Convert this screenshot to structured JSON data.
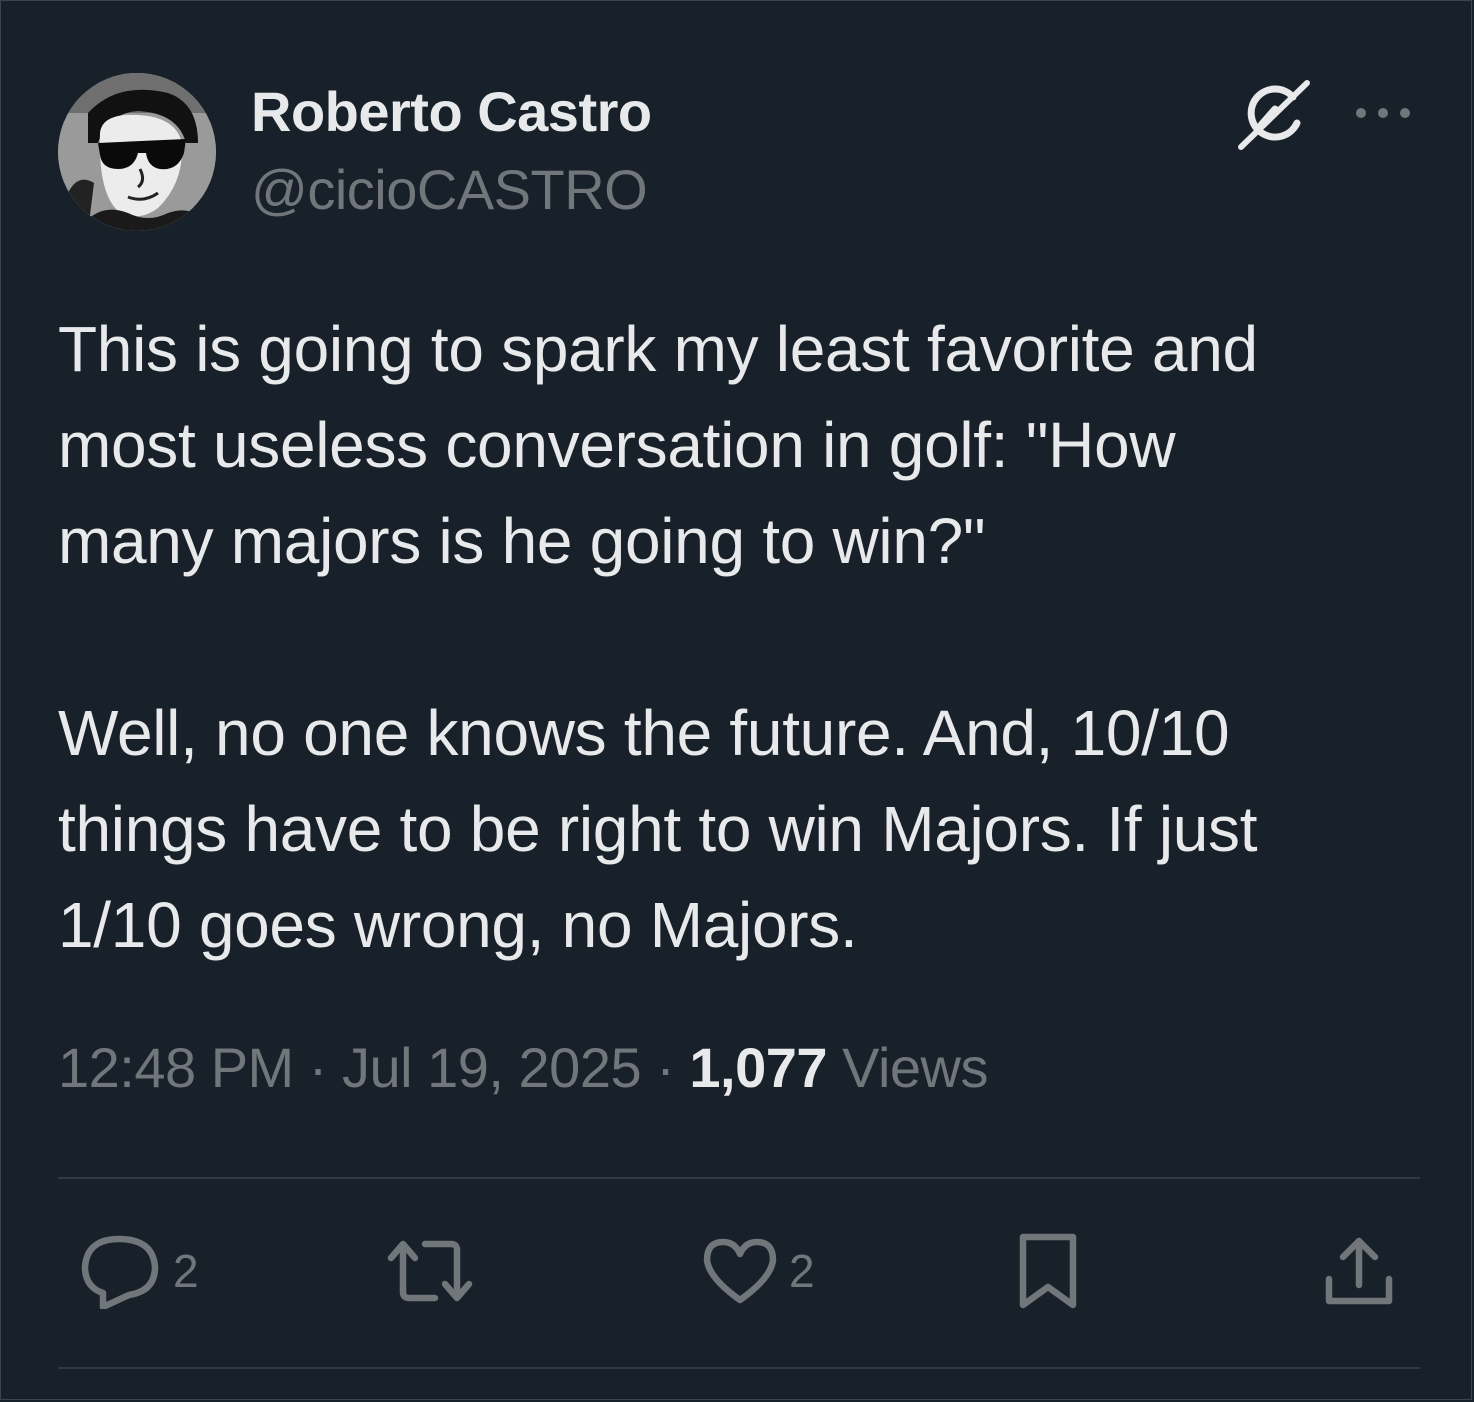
{
  "author": {
    "display_name": "Roberto Castro",
    "handle": "@cicioCASTRO"
  },
  "tweet": {
    "paragraphs": [
      [
        "This is going to spark my least favorite and",
        "most useless conversation in golf: \"How",
        "many majors is he going to win?\""
      ],
      [
        "Well, no one knows the future. And, 10/10",
        "things have to be right to win Majors. If just",
        "1/10 goes wrong, no Majors."
      ]
    ]
  },
  "meta": {
    "time": "12:48 PM",
    "separator": "·",
    "date": "Jul 19, 2025",
    "views_count": "1,077",
    "views_label": "Views"
  },
  "actions": {
    "reply_count": "2",
    "repost_count": "",
    "like_count": "2"
  },
  "icons": [
    "grok-icon",
    "more-icon",
    "reply-icon",
    "repost-icon",
    "like-icon",
    "bookmark-icon",
    "share-icon"
  ],
  "colors": {
    "background": "#18202a",
    "text_primary": "#e7e9ea",
    "text_secondary": "#71767b",
    "divider": "#2f3a43"
  }
}
